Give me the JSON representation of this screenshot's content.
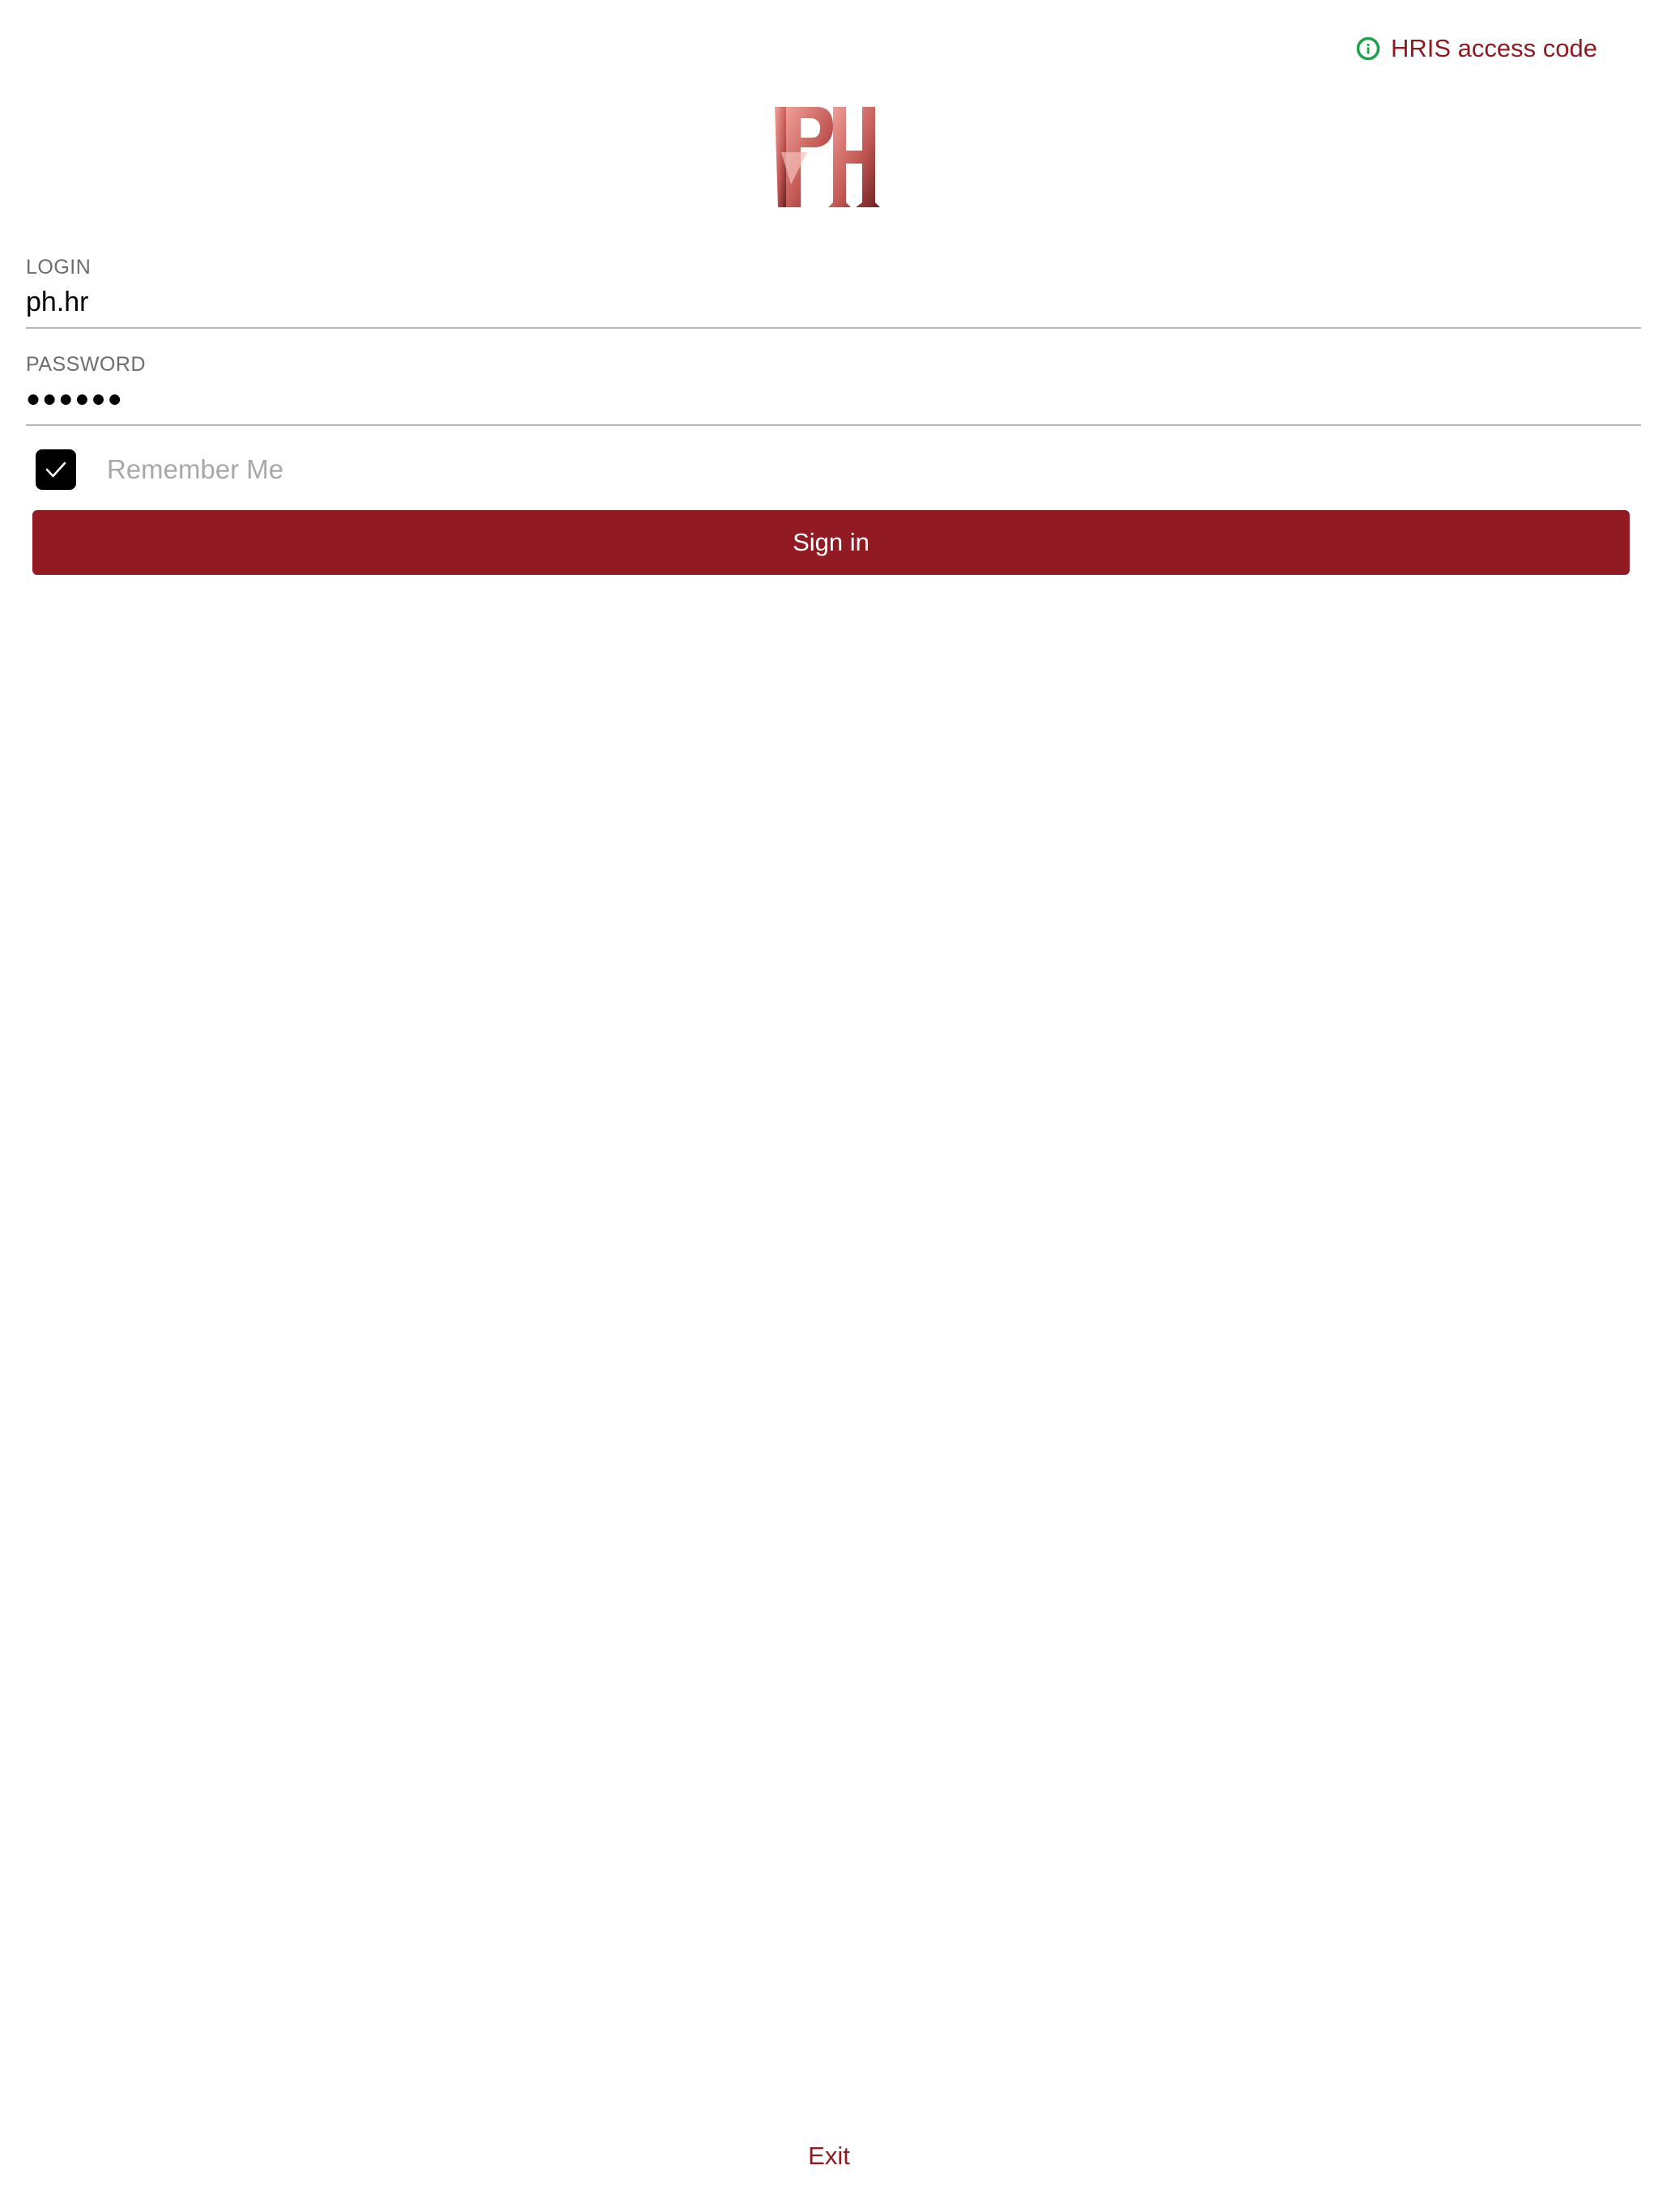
{
  "header": {
    "access_code_label": "HRIS access code",
    "access_code_icon": "info-circle-icon",
    "icon_color": "#1ca34a"
  },
  "logo": {
    "text": "PH"
  },
  "login": {
    "label": "LOGIN",
    "value": "ph.hr"
  },
  "password": {
    "label": "PASSWORD",
    "value": "●●●●●●"
  },
  "remember": {
    "label": "Remember Me",
    "checked": true
  },
  "actions": {
    "sign_in_label": "Sign in",
    "exit_label": "Exit"
  },
  "colors": {
    "accent": "#921a22",
    "link": "#8e1a22"
  }
}
